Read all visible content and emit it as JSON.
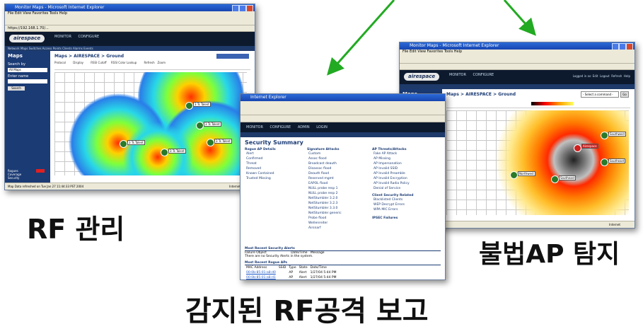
{
  "captions": {
    "rf_management": "RF 관리",
    "rogue_ap_detection": "불법AP 탐지",
    "rf_attack_report": "감지된 RF공격 보고"
  },
  "left_window": {
    "title": "Monitor Maps - Microsoft Internet Explorer",
    "menu": "File  Edit  View  Favorites  Tools  Help",
    "address": "https://192.168.1.70/...",
    "logo": "airespace",
    "nav_tabs": [
      "MONITOR",
      "CONFIGURE"
    ],
    "subnav": "Network  Maps  Switches  Access Points  Clients  Alarms  Events",
    "sidebar_title": "Maps",
    "search_by": "Search by",
    "search_value": "All Maps",
    "enter_name": "Enter name",
    "search_button": "Search",
    "alarm_rows": [
      "Rogues",
      "Coverage",
      "Security"
    ],
    "breadcrumb": "Maps > AIRESPACE > Ground",
    "header_controls": [
      "Protocol",
      "Display",
      "RSSI Cutoff",
      "RSSI Color Lookup",
      "Refresh",
      "Zoom"
    ],
    "ap_labels": [
      "3 Ts Talent",
      "3 Ts Talent",
      "3 Ts Talent",
      "3 Ts Talent",
      "3 Ts Talent"
    ],
    "status": "Map Data refreshed on Tue Jan 27 11:44:33 PST 2004",
    "status_zone": "Internet"
  },
  "middle_window": {
    "title": "Internet Explorer",
    "nav_tabs": [
      "MONITOR",
      "CONFIGURE",
      "ADMIN",
      "LOGIN"
    ],
    "section_title": "Security Summary",
    "col1_header": "Rogue AP Details",
    "col1_rows": [
      "Alert",
      "Confirmed",
      "Threat",
      "Removed",
      "Known Contained",
      "Trusted Missing"
    ],
    "col2_header": "Signature Attacks",
    "col2_rows": [
      "Custom",
      "Assoc flood",
      "Broadcast deauth",
      "Disassoc flood",
      "Deauth flood",
      "Reserved mgmt",
      "EAPOL flood",
      "NULL probe resp 1",
      "NULL probe resp 2",
      "NetStumbler 3.2.0",
      "NetStumbler 3.2.3",
      "NetStumbler 3.3.0",
      "NetStumbler generic",
      "Probe flood",
      "Wellenreiter",
      "Airsnarf"
    ],
    "col3_header": "AP Threats/Attacks",
    "col3_rows": [
      "Fake AP Attack",
      "AP Missing",
      "AP Impersonation",
      "AP Invalid SSID",
      "AP Invalid Preamble",
      "AP Invalid Encryption",
      "AP Invalid Radio Policy",
      "Denial of Service"
    ],
    "col3b_header": "Client Security Related",
    "col3b_rows": [
      "Blacklisted Clients",
      "WEP Decrypt Errors",
      "WPA MIC Errors"
    ],
    "ipsec": "IPSEC Failures",
    "recent_alerts_title": "Most Recent Security Alerts",
    "recent_alerts_cols": [
      "Failure Object",
      "Date/Time",
      "Message"
    ],
    "recent_alerts_note": "There are no Security Alerts in the system.",
    "rogue_title": "Most Recent Rogue APs",
    "rogue_cols": [
      "MAC Address",
      "SSID",
      "Type",
      "State",
      "Date/Time"
    ],
    "rogue_rows": [
      [
        "00:0b:85:01:a8:d0",
        "AP",
        "Alert",
        "1/27/04 5:44 PM"
      ],
      [
        "00:0b:85:01:a8:d1",
        "AP",
        "Alert",
        "1/27/04 5:44 PM"
      ]
    ]
  },
  "right_window": {
    "title": "Monitor Maps - Microsoft Internet Explorer",
    "menu": "File  Edit  View  Favorites  Tools  Help",
    "logo": "airespace",
    "nav_tabs": [
      "MONITOR",
      "CONFIGURE"
    ],
    "top_links": [
      "Logged in as: Edit",
      "Logout",
      "Refresh",
      "Help"
    ],
    "sidebar_title": "Maps",
    "breadcrumb": "Maps > AIRESPACE > Ground",
    "select_command": "- Select a command -",
    "go": "Go",
    "ap_labels": [
      "Southwest",
      "Southeast",
      "Airespace",
      "Northwest",
      "Southeast"
    ],
    "status_zone": "Internet"
  },
  "colors": {
    "arrow": "#22aa22",
    "ie_title": "#1d55c4",
    "airespace_nav": "#0d1a2e",
    "sidebar": "#1b3b74"
  }
}
